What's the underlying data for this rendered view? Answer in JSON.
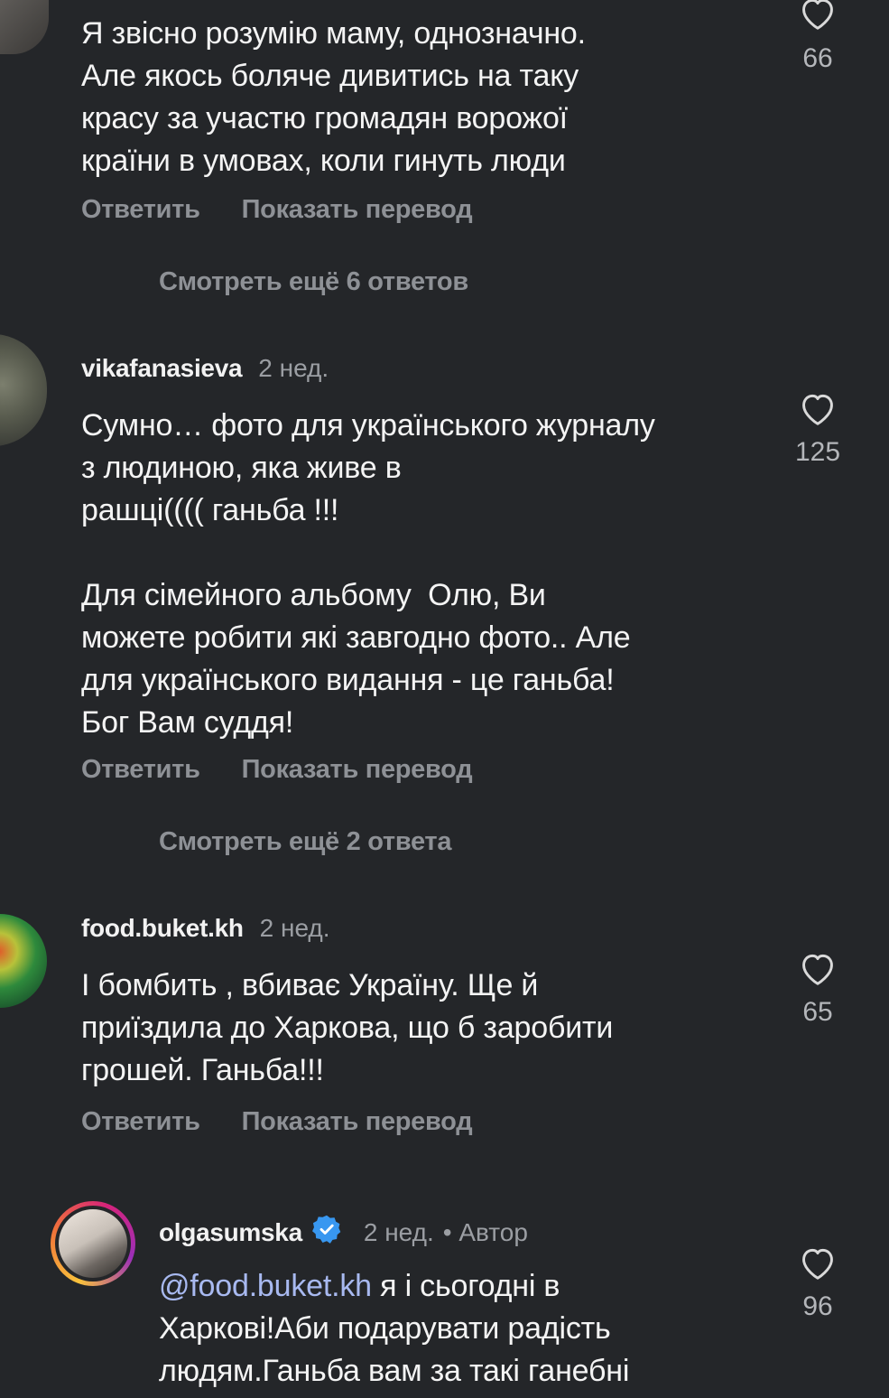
{
  "comments": [
    {
      "text": "Я звісно розумію маму, однозначно.\nАле якось боляче дивитись на таку\nкрасу за участю громадян ворожої\nкраїни в умовах, коли гинуть люди",
      "likes": "66",
      "reply_label": "Ответить",
      "translate_label": "Показать перевод",
      "view_more": "Смотреть ещё 6 ответов"
    },
    {
      "username": "vikafanasieva",
      "time": "2 нед.",
      "text": "Сумно… фото для українського журналу\nз людиною, яка живе в\nрашці(((( ганьба !!!\n\nДля сімейного альбому  Олю, Ви\nможете робити які завгодно фото.. Але\nдля українського видання - це ганьба!\nБог Вам суддя!",
      "likes": "125",
      "reply_label": "Ответить",
      "translate_label": "Показать перевод",
      "view_more": "Смотреть ещё 2 ответа"
    },
    {
      "username": "food.buket.kh",
      "time": "2 нед.",
      "text": "І бомбить , вбиває Україну. Ще й\nприїздила до Харкова, що б заробити\nгрошей. Ганьба!!!",
      "likes": "65",
      "reply_label": "Ответить",
      "translate_label": "Показать перевод"
    },
    {
      "username": "olgasumska",
      "time": "2 нед.",
      "author_tag": "• Автор",
      "mention": "@food.buket.kh",
      "text": " я і сьогодні в\nХаркові!Аби подарувати радість\nлюдям.Ганьба вам за такі ганебні",
      "likes": "96"
    }
  ],
  "colors": {
    "background": "#242629",
    "text": "#f4f4f4",
    "muted": "#8e9196",
    "mention": "#a8b9f0",
    "verified": "#3897f0"
  },
  "icons": [
    "heart-outline-icon",
    "verified-badge-icon"
  ]
}
